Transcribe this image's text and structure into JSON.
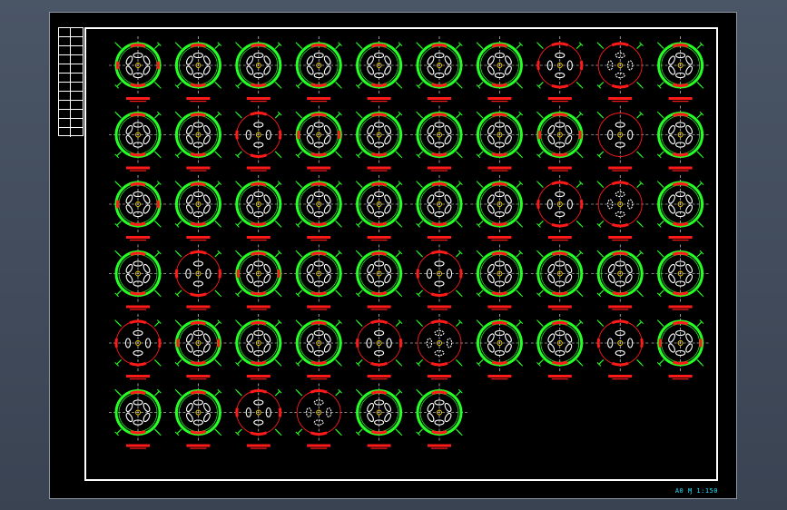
{
  "drawing": {
    "sheet_label": "A0 Ɱ 1:150",
    "rows": [
      10,
      10,
      10,
      10,
      10,
      6
    ],
    "colors": {
      "ring": "#26ff26",
      "bolt": "#ffffff",
      "arc": "#ff1a1a",
      "axis": "#ffffff",
      "label": "#ff1a1a",
      "dimension": "#26ff26"
    },
    "styles": [
      "C",
      "A",
      "A",
      "B",
      "A",
      "A",
      "A",
      "D",
      "E",
      "A",
      "A",
      "A",
      "D",
      "C",
      "A",
      "B",
      "A",
      "C",
      "F",
      "A",
      "C",
      "A",
      "B",
      "A",
      "A",
      "B",
      "A",
      "D",
      "E",
      "A",
      "B",
      "D",
      "C",
      "B",
      "A",
      "D",
      "A",
      "A",
      "B",
      "A",
      "D",
      "C",
      "B",
      "A",
      "D",
      "E",
      "A",
      "B",
      "D",
      "C",
      "B",
      "A",
      "D",
      "E",
      "A",
      "B"
    ]
  }
}
